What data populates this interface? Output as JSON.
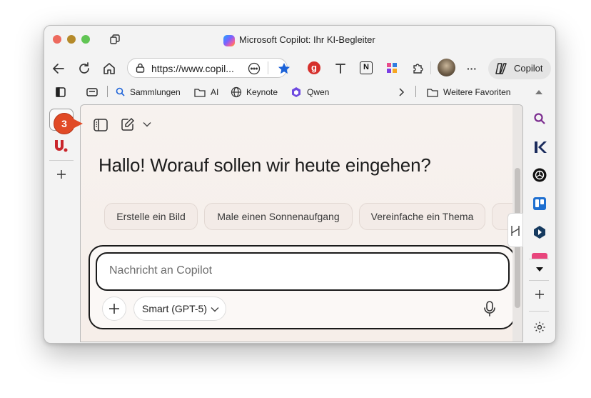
{
  "window": {
    "title": "Microsoft Copilot: Ihr KI-Begleiter",
    "traffic_colors": [
      "#ed6a5e",
      "#b58a2a",
      "#61c554"
    ]
  },
  "toolbar": {
    "url": "https://www.copil...",
    "copilot_label": "Copilot",
    "more_label": "···"
  },
  "bookmarks": {
    "items": [
      {
        "label": "Sammlungen",
        "icon": "search-icon"
      },
      {
        "label": "AI",
        "icon": "folder-icon"
      },
      {
        "label": "Keynote",
        "icon": "globe-icon"
      },
      {
        "label": "Qwen",
        "icon": "qwen-icon"
      }
    ],
    "more_favorites": "Weitere Favoriten"
  },
  "copilot": {
    "heading": "Hallo! Worauf sollen wir heute eingehen?",
    "suggestions": [
      "Erstelle ein Bild",
      "Male einen Sonnenaufgang",
      "Vereinfache ein Thema"
    ],
    "input_placeholder": "Nachricht an Copilot",
    "input_value": "",
    "model_label": "Smart (GPT-5)"
  },
  "annotation": {
    "step_number": "3",
    "color": "#e14a26"
  },
  "colors": {
    "accent_blue": "#1d63d8",
    "content_bg": "#f7f2ef"
  }
}
